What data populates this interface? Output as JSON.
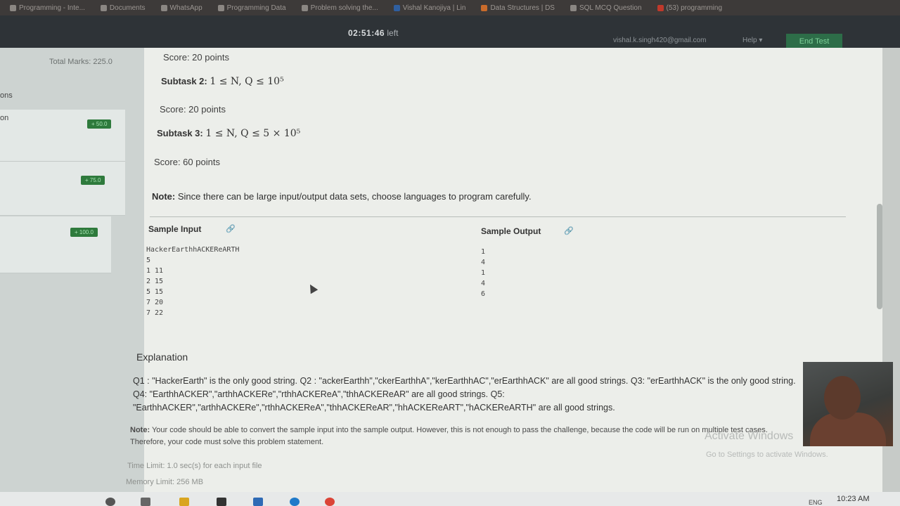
{
  "bookmarks": [
    {
      "label": "Programming - Inte..."
    },
    {
      "label": "Documents"
    },
    {
      "label": "WhatsApp"
    },
    {
      "label": "Programming Data"
    },
    {
      "label": "Problem solving the..."
    },
    {
      "label": "Vishal Kanojiya | Lin"
    },
    {
      "label": "Data Structures | DS"
    },
    {
      "label": "SQL MCQ Question"
    },
    {
      "label": "(53) programming"
    }
  ],
  "header": {
    "timer": "02:51:46",
    "timer_suffix": "left",
    "user_email": "vishal.k.singh420@gmail.com",
    "help_label": "Help ▾",
    "end_test_label": "End Test"
  },
  "sidebar": {
    "total_marks": "Total Marks: 225.0",
    "section_label": "ons",
    "items": [
      {
        "label": "on",
        "badge": "+ 50.0"
      },
      {
        "label": "",
        "badge": "+ 75.0"
      },
      {
        "label": "",
        "badge": "+ 100.0"
      }
    ]
  },
  "problem": {
    "score1": "Score: 20 points",
    "subtask2_label": "Subtask 2:",
    "subtask2_math": "1 ≤ N, Q ≤ 10⁵",
    "score2": "Score: 20 points",
    "subtask3_label": "Subtask 3:",
    "subtask3_math": "1 ≤ N, Q ≤ 5 × 10⁵",
    "score3": "Score: 60 points",
    "note_label": "Note:",
    "note_text": " Since there can be large input/output data sets, choose languages to program carefully.",
    "sample_input_title": "Sample Input",
    "sample_output_title": "Sample Output",
    "sample_input": "HackerEarthhACKEReARTH\n5\n1 11\n2 15\n5 15\n7 20\n7 22",
    "sample_output": "1\n4\n1\n4\n6",
    "explanation_title": "Explanation",
    "explanation_text": "Q1 : \"HackerEarth\" is the only good string. Q2 : \"ackerEarthh\",\"ckerEarthhA\",\"kerEarthhAC\",\"erEarthhACK\" are all good strings. Q3: \"erEarthhACK\" is the only good string. Q4: \"EarthhACKER\",\"arthhACKERe\",\"rthhACKEReA\",\"thhACKEReAR\" are all good strings. Q5: \"EarthhACKER\",\"arthhACKERe\",\"rthhACKEReA\",\"thhACKEReAR\",\"hhACKEReART\",\"hACKEReARTH\" are all good strings.",
    "footnote_label": "Note:",
    "footnote_text": " Your code should be able to convert the sample input into the sample output. However, this is not enough to pass the challenge, because the code will be run on multiple test cases. Therefore, your code must solve this problem statement.",
    "time_limit": "Time Limit: 1.0 sec(s) for each input file",
    "memory_limit": "Memory Limit: 256 MB"
  },
  "overlay": {
    "activate_title": "Activate Windows",
    "activate_sub": "Go to Settings to activate Windows."
  },
  "taskbar": {
    "clock": "10:23 AM",
    "lang": "ENG"
  }
}
